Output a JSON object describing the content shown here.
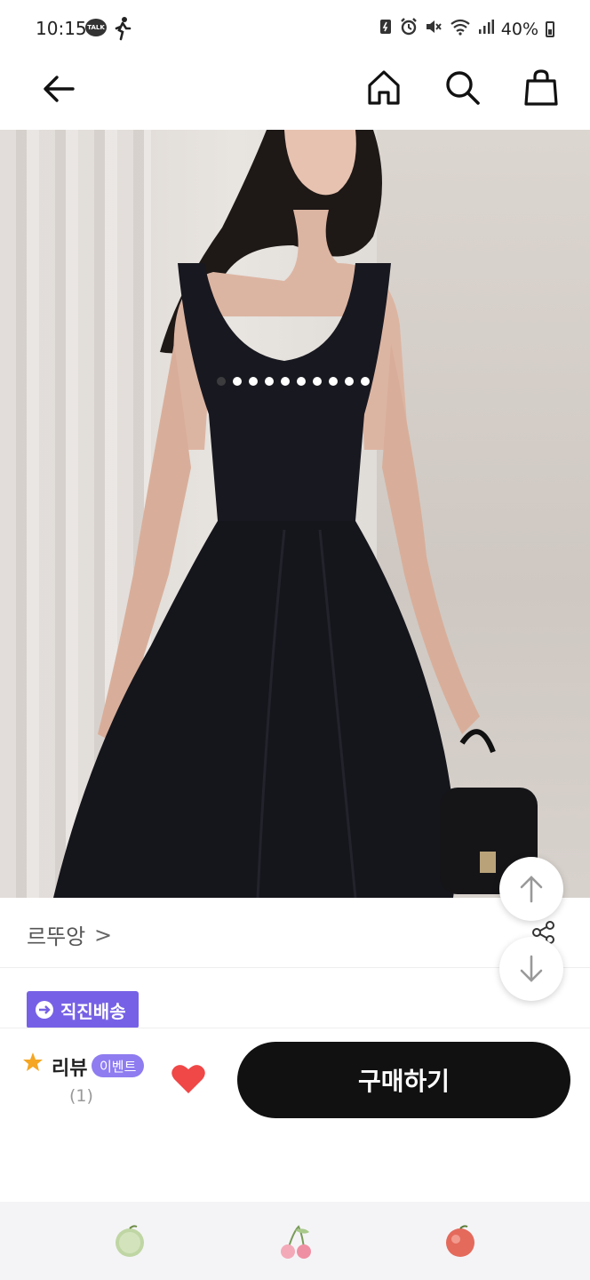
{
  "status_bar": {
    "time": "10:15",
    "talk_badge": "TALK",
    "battery": "40%",
    "icons": [
      "battery-saver-icon",
      "alarm-icon",
      "mute-icon",
      "wifi-icon",
      "signal-icon",
      "battery-icon"
    ]
  },
  "app_bar": {
    "icons": [
      "back-arrow-icon",
      "home-icon",
      "search-icon",
      "shopping-bag-icon"
    ]
  },
  "product": {
    "image_count": 10,
    "current_image": 1,
    "brand": "르뚜앙",
    "brand_chevron": ">",
    "shipping_badge": "직진배송"
  },
  "buy_bar": {
    "review_label": "리뷰",
    "event_chip": "이벤트",
    "review_count": "(1)",
    "buy_button": "구매하기",
    "heart_color": "#f04747"
  },
  "bottom_nav": {
    "icons": [
      "green-apple-icon",
      "cherry-icon",
      "red-apple-icon"
    ]
  },
  "colors": {
    "accent_purple": "#7661e6",
    "buy_button": "#111111",
    "star": "#f5a623"
  }
}
